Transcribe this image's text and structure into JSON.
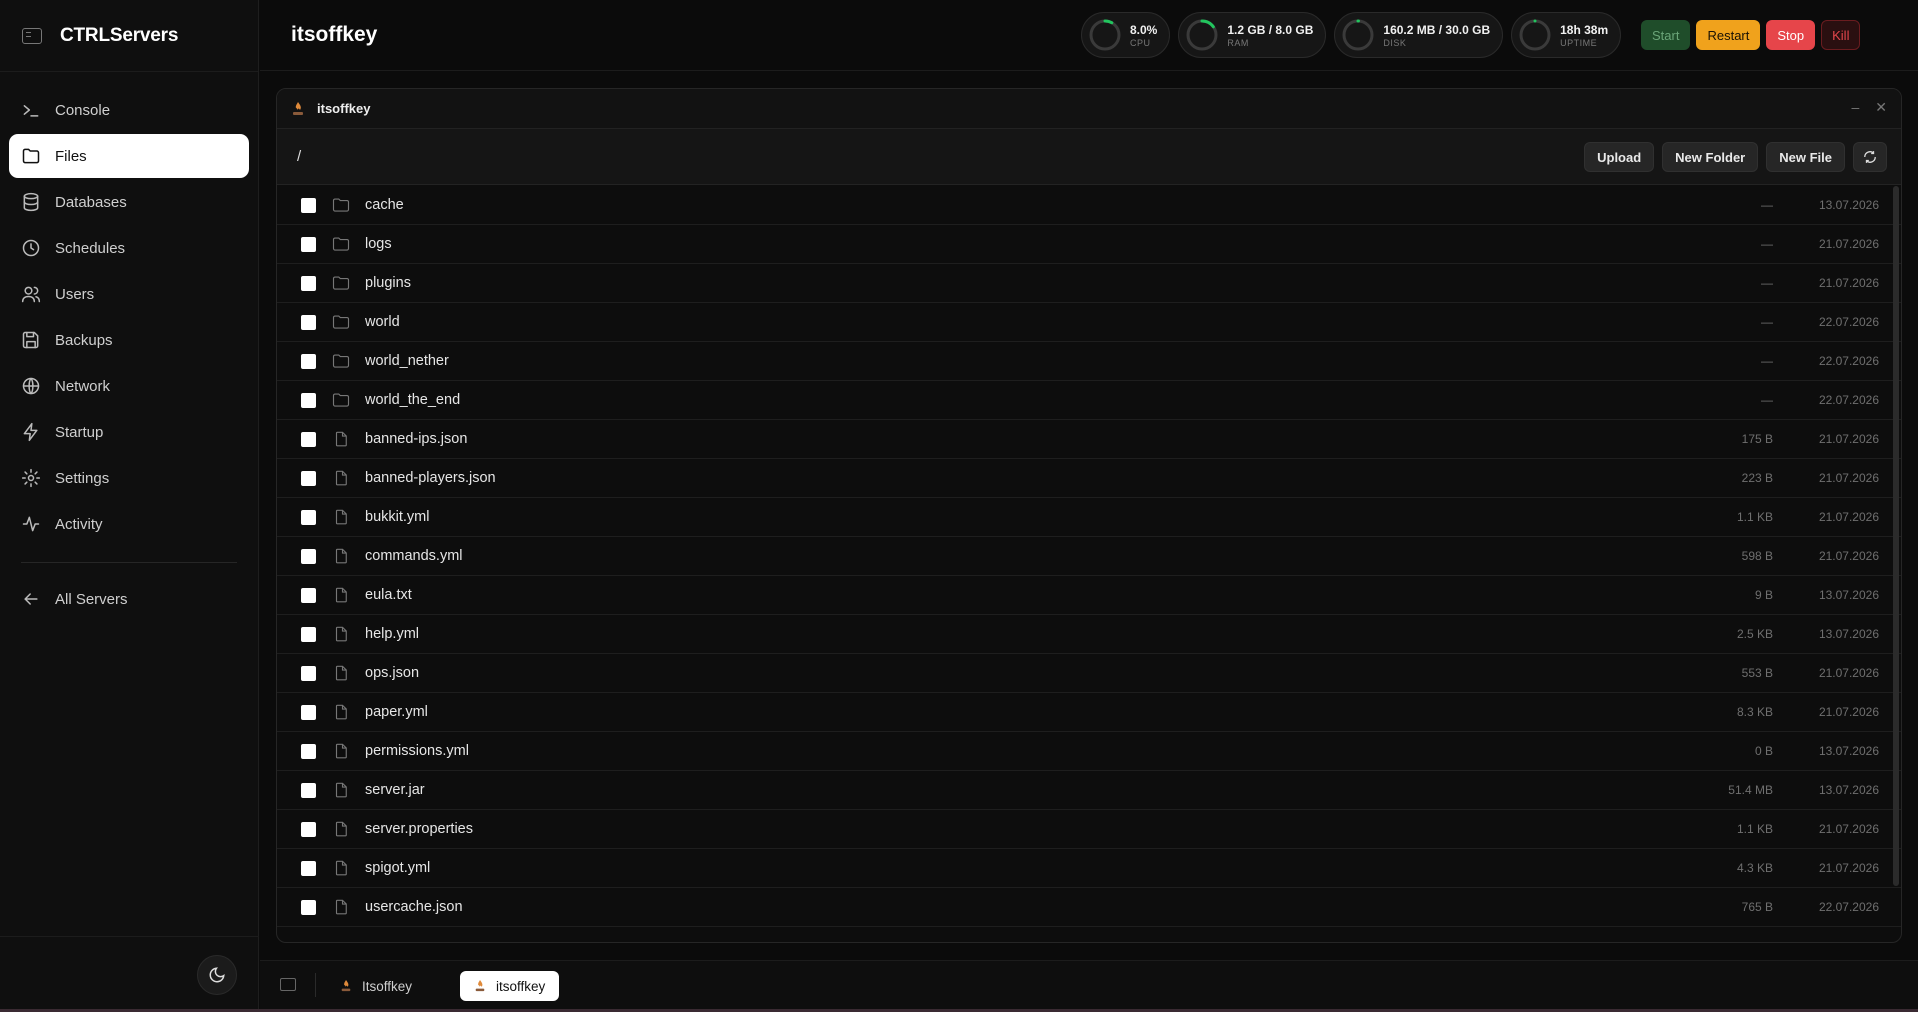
{
  "brand": {
    "title": "CTRLServers"
  },
  "nav": [
    {
      "label": "Console",
      "icon": "terminal-icon",
      "active": false
    },
    {
      "label": "Files",
      "icon": "folder-icon",
      "active": true
    },
    {
      "label": "Databases",
      "icon": "database-icon",
      "active": false
    },
    {
      "label": "Schedules",
      "icon": "clock-icon",
      "active": false
    },
    {
      "label": "Users",
      "icon": "users-icon",
      "active": false
    },
    {
      "label": "Backups",
      "icon": "save-icon",
      "active": false
    },
    {
      "label": "Network",
      "icon": "globe-icon",
      "active": false
    },
    {
      "label": "Startup",
      "icon": "bolt-icon",
      "active": false
    },
    {
      "label": "Settings",
      "icon": "gear-icon",
      "active": false
    },
    {
      "label": "Activity",
      "icon": "activity-icon",
      "active": false
    }
  ],
  "all_servers": {
    "label": "All Servers"
  },
  "header": {
    "server_title": "itsoffkey"
  },
  "stats": [
    {
      "value": "8.0%",
      "label": "CPU",
      "level": 0.08
    },
    {
      "value": "1.2 GB / 8.0 GB",
      "label": "RAM",
      "level": 0.15
    },
    {
      "value": "160.2 MB / 30.0 GB",
      "label": "DISK",
      "level": 0.005
    },
    {
      "value": "18h 38m",
      "label": "UPTIME",
      "level": 0
    }
  ],
  "power": {
    "start": "Start",
    "restart": "Restart",
    "stop": "Stop",
    "kill": "Kill"
  },
  "panel": {
    "title": "itsoffkey"
  },
  "toolbar": {
    "path": "/",
    "upload": "Upload",
    "new_folder": "New Folder",
    "new_file": "New File"
  },
  "files": [
    {
      "name": "cache",
      "type": "folder",
      "size": "—",
      "date": "13.07.2026"
    },
    {
      "name": "logs",
      "type": "folder",
      "size": "—",
      "date": "21.07.2026"
    },
    {
      "name": "plugins",
      "type": "folder",
      "size": "—",
      "date": "21.07.2026"
    },
    {
      "name": "world",
      "type": "folder",
      "size": "—",
      "date": "22.07.2026"
    },
    {
      "name": "world_nether",
      "type": "folder",
      "size": "—",
      "date": "22.07.2026"
    },
    {
      "name": "world_the_end",
      "type": "folder",
      "size": "—",
      "date": "22.07.2026"
    },
    {
      "name": "banned-ips.json",
      "type": "file",
      "size": "175 B",
      "date": "21.07.2026"
    },
    {
      "name": "banned-players.json",
      "type": "file",
      "size": "223 B",
      "date": "21.07.2026"
    },
    {
      "name": "bukkit.yml",
      "type": "file",
      "size": "1.1 KB",
      "date": "21.07.2026"
    },
    {
      "name": "commands.yml",
      "type": "file",
      "size": "598 B",
      "date": "21.07.2026"
    },
    {
      "name": "eula.txt",
      "type": "file",
      "size": "9 B",
      "date": "13.07.2026"
    },
    {
      "name": "help.yml",
      "type": "file",
      "size": "2.5 KB",
      "date": "13.07.2026"
    },
    {
      "name": "ops.json",
      "type": "file",
      "size": "553 B",
      "date": "21.07.2026"
    },
    {
      "name": "paper.yml",
      "type": "file",
      "size": "8.3 KB",
      "date": "21.07.2026"
    },
    {
      "name": "permissions.yml",
      "type": "file",
      "size": "0 B",
      "date": "13.07.2026"
    },
    {
      "name": "server.jar",
      "type": "file",
      "size": "51.4 MB",
      "date": "13.07.2026"
    },
    {
      "name": "server.properties",
      "type": "file",
      "size": "1.1 KB",
      "date": "21.07.2026"
    },
    {
      "name": "spigot.yml",
      "type": "file",
      "size": "4.3 KB",
      "date": "21.07.2026"
    },
    {
      "name": "usercache.json",
      "type": "file",
      "size": "765 B",
      "date": "22.07.2026"
    }
  ],
  "taskbar": [
    {
      "label": "Itsoffkey",
      "active": false
    },
    {
      "label": "itsoffkey",
      "active": true
    }
  ],
  "colors": {
    "accent_green": "#22c55e",
    "restart": "#f0a21c",
    "stop": "#e6454a"
  }
}
